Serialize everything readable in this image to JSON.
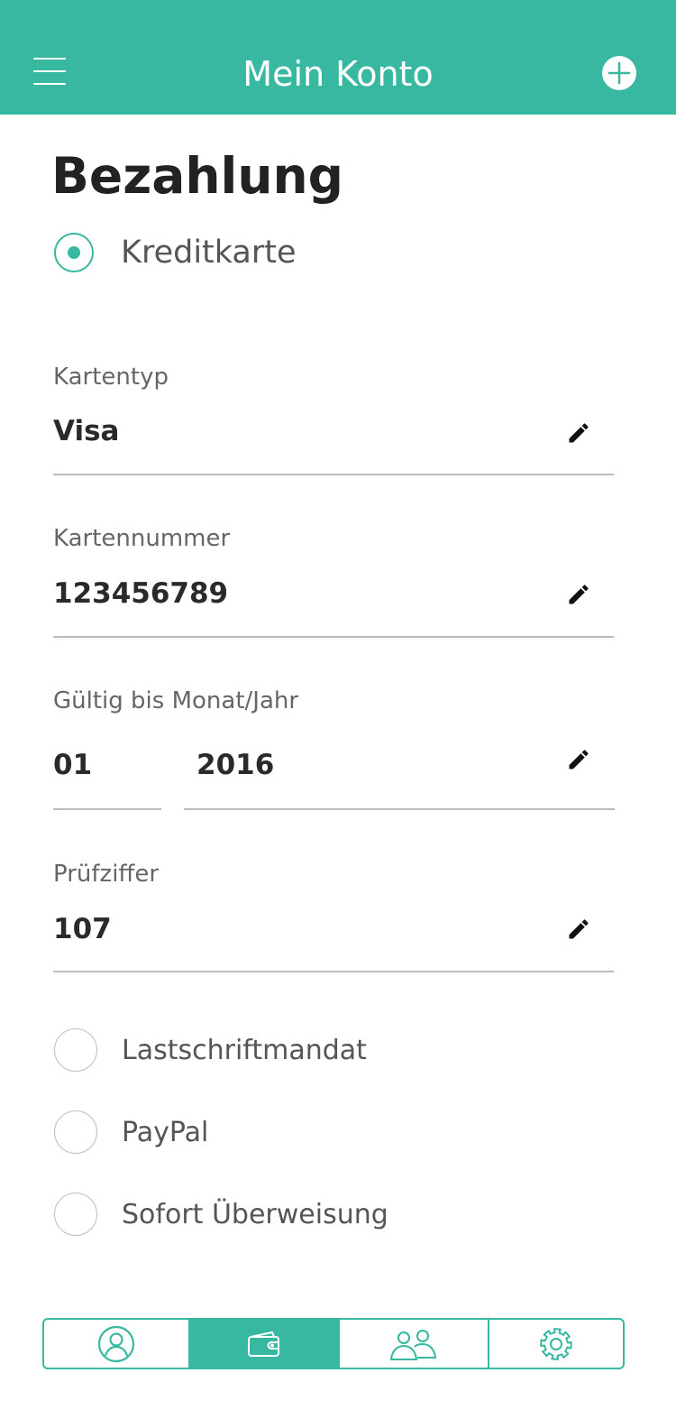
{
  "header": {
    "title": "Mein Konto",
    "menu_icon": "hamburger-menu-icon",
    "add_icon": "plus-circle-icon"
  },
  "page": {
    "title": "Bezahlung"
  },
  "payment_methods": {
    "selected": "Kreditkarte",
    "credit_card": {
      "label": "Kreditkarte",
      "selected": true
    },
    "others": [
      {
        "label": "Lastschriftmandat",
        "selected": false
      },
      {
        "label": "PayPal",
        "selected": false
      },
      {
        "label": "Sofort Überweisung",
        "selected": false
      }
    ]
  },
  "fields": {
    "card_type": {
      "label": "Kartentyp",
      "value": "Visa"
    },
    "card_number": {
      "label": "Kartennummer",
      "value": "123456789"
    },
    "expiry": {
      "label": "Gültig bis Monat/Jahr",
      "month": "01",
      "year": "2016"
    },
    "check_digit": {
      "label": "Prüfziffer",
      "value": "107"
    }
  },
  "tabs": [
    {
      "name": "profile",
      "icon": "user-icon",
      "active": false
    },
    {
      "name": "payment",
      "icon": "wallet-icon",
      "active": true
    },
    {
      "name": "group",
      "icon": "users-icon",
      "active": false
    },
    {
      "name": "settings",
      "icon": "gear-icon",
      "active": false
    }
  ],
  "colors": {
    "accent": "#38b8a0",
    "text_dark": "#2a2a2a",
    "text_muted": "#666666",
    "divider": "#bcbcbc"
  }
}
